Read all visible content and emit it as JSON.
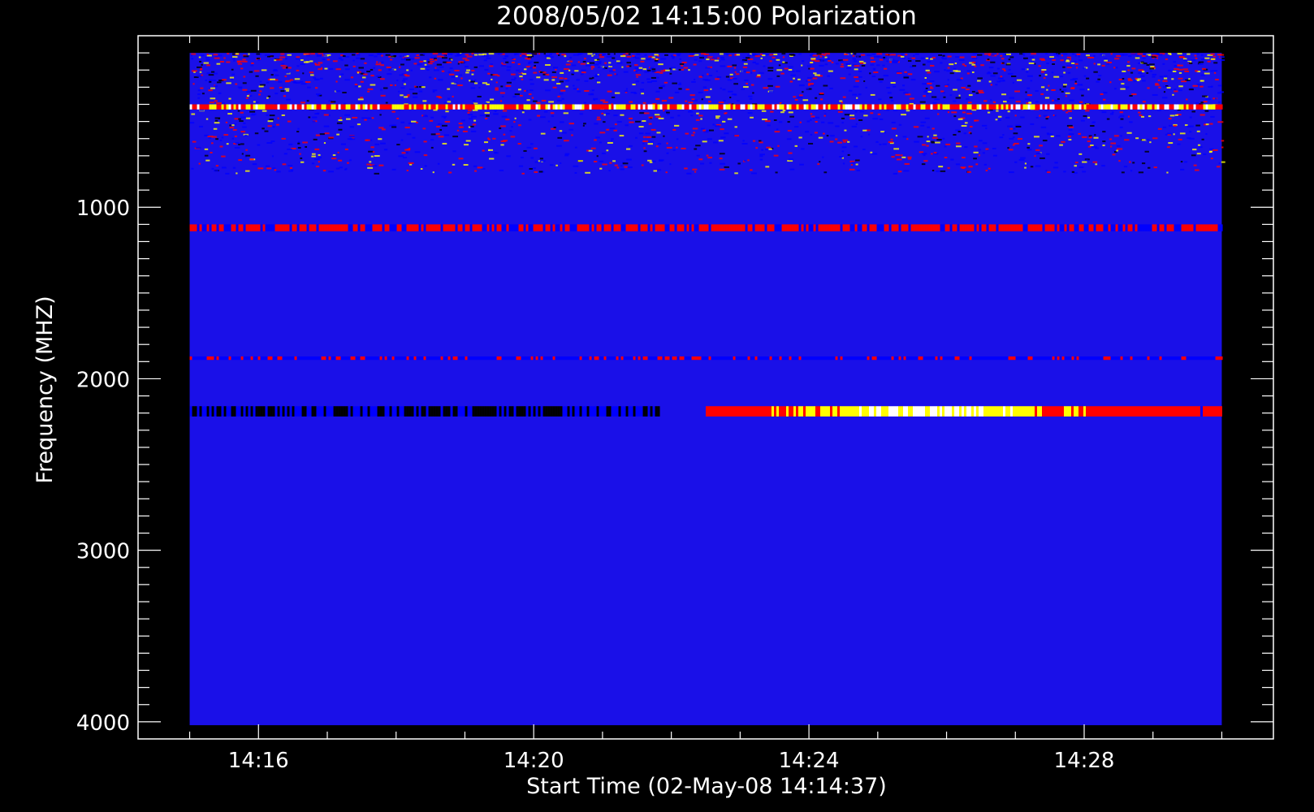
{
  "chart_data": {
    "type": "heatmap",
    "title": "2008/05/02 14:15:00 Polarization",
    "xlabel": "Start Time (02-May-08 14:14:37)",
    "ylabel": "Frequency (MHZ)",
    "x_major_ticks": [
      {
        "minute": 16,
        "label": "14:16"
      },
      {
        "minute": 20,
        "label": "14:20"
      },
      {
        "minute": 24,
        "label": "14:24"
      },
      {
        "minute": 28,
        "label": "14:28"
      }
    ],
    "x_minor_step_min": 1,
    "xlim_min": [
      14.25,
      30.75
    ],
    "data_xlim_min": [
      15.0,
      30.0
    ],
    "y_major_ticks": [
      {
        "value": 1000,
        "label": "1000"
      },
      {
        "value": 2000,
        "label": "2000"
      },
      {
        "value": 3000,
        "label": "3000"
      },
      {
        "value": 4000,
        "label": "4000"
      }
    ],
    "y_minor_step": 100,
    "ylim": [
      0,
      4100
    ],
    "data_ylim": [
      100,
      4020
    ],
    "y_reversed": true,
    "colormap": [
      "#000000",
      "#0000ff",
      "#ff0000",
      "#ffff00",
      "#ffffff"
    ],
    "background_color": "#1a10e8",
    "features": [
      {
        "name": "interference-top",
        "freq": [
          100,
          800
        ],
        "t": [
          15.0,
          30.0
        ],
        "level": 0.55
      },
      {
        "name": "band-400",
        "freq": [
          400,
          430
        ],
        "t": [
          15.0,
          30.0
        ],
        "level": 0.9
      },
      {
        "name": "band-1120",
        "freq": [
          1100,
          1140
        ],
        "t": [
          15.0,
          30.0
        ],
        "level": 0.6
      },
      {
        "name": "line-1880",
        "freq": [
          1870,
          1890
        ],
        "t": [
          15.0,
          30.0
        ],
        "level": 0.45
      },
      {
        "name": "polarized-2200",
        "freq": [
          2160,
          2220
        ],
        "t": [
          22.5,
          30.0
        ],
        "level": 0.95
      },
      {
        "name": "dark-2200",
        "freq": [
          2160,
          2220
        ],
        "t": [
          15.0,
          21.8
        ],
        "level": 0.0
      }
    ]
  }
}
